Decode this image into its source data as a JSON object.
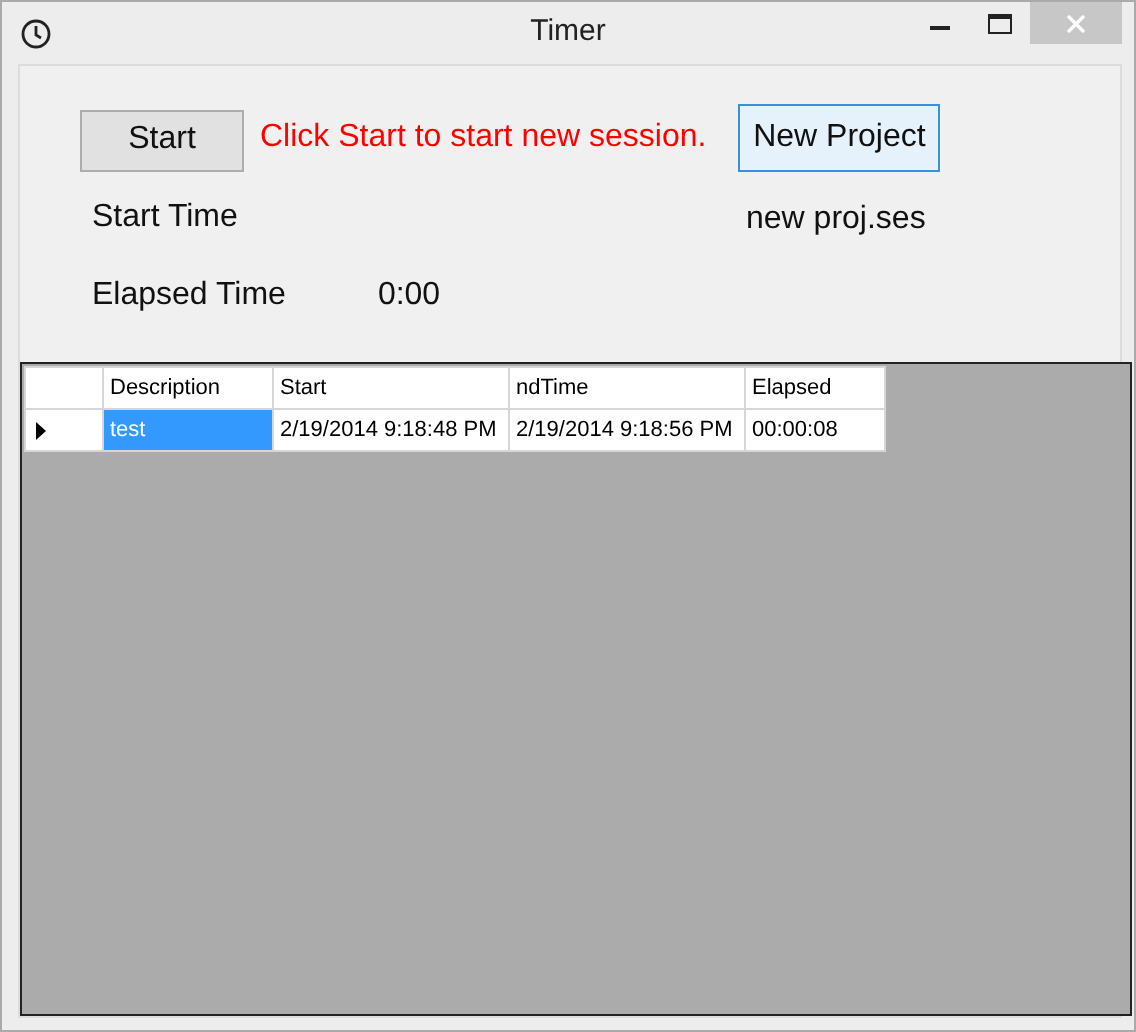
{
  "window": {
    "title": "Timer"
  },
  "start_button": "Start",
  "message": "Click Start to start new session.",
  "new_project_button": "New Project",
  "start_time_label": "Start Time",
  "project_file": "new proj.ses",
  "elapsed_label": "Elapsed Time",
  "elapsed_value": "0:00",
  "table": {
    "columns": [
      "Description",
      "Start",
      "ndTime",
      "Elapsed"
    ],
    "rows": [
      {
        "current": true,
        "cells": [
          {
            "text": "test",
            "selected": true
          },
          {
            "text": "2/19/2014 9:18:48 PM",
            "selected": false
          },
          {
            "text": "2/19/2014 9:18:56 PM",
            "selected": false
          },
          {
            "text": "00:00:08",
            "selected": false
          }
        ]
      }
    ]
  }
}
